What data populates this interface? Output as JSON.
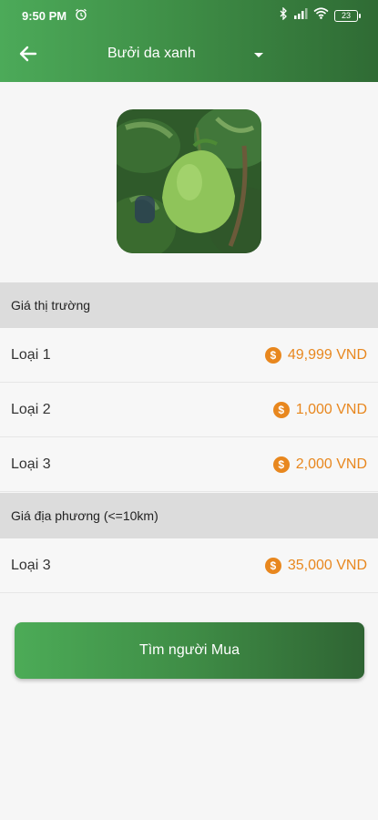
{
  "status_bar": {
    "time": "9:50 PM",
    "battery": "23"
  },
  "header": {
    "title": "Bưởi da xanh"
  },
  "market_section": {
    "title": "Giá thị trường",
    "rows": [
      {
        "label": "Loại 1",
        "price": "49,999 VND"
      },
      {
        "label": "Loại 2",
        "price": "1,000 VND"
      },
      {
        "label": "Loại 3",
        "price": "2,000 VND"
      }
    ]
  },
  "local_section": {
    "title": "Giá địa phương (<=10km)",
    "rows": [
      {
        "label": "Loại 3",
        "price": "35,000 VND"
      }
    ]
  },
  "action": {
    "find_buyer_label": "Tìm người Mua"
  },
  "colors": {
    "brand_green": "#3f8f47",
    "price_orange": "#e8871e",
    "section_bg": "#dcdcdc"
  },
  "icons": [
    "back-arrow-icon",
    "dropdown-caret-icon",
    "coin-icon",
    "alarm-icon",
    "bluetooth-icon",
    "signal-icon",
    "wifi-icon",
    "battery-icon"
  ]
}
